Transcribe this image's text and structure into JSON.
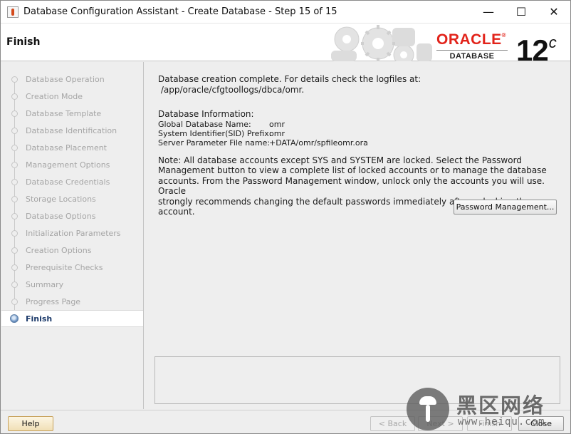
{
  "window": {
    "title": "Database Configuration Assistant - Create Database - Step 15 of 15",
    "minimize_glyph": "—",
    "maximize_glyph": "☐",
    "close_glyph": "✕"
  },
  "header": {
    "step_title": "Finish",
    "logo_word": "ORACLE",
    "logo_registered": "®",
    "logo_sub": "DATABASE",
    "version": "12",
    "version_suffix": "c"
  },
  "nav": {
    "items": [
      {
        "label": "Database Operation"
      },
      {
        "label": "Creation Mode"
      },
      {
        "label": "Database Template"
      },
      {
        "label": "Database Identification"
      },
      {
        "label": "Database Placement"
      },
      {
        "label": "Management Options"
      },
      {
        "label": "Database Credentials"
      },
      {
        "label": "Storage Locations"
      },
      {
        "label": "Database Options"
      },
      {
        "label": "Initialization Parameters"
      },
      {
        "label": "Creation Options"
      },
      {
        "label": "Prerequisite Checks"
      },
      {
        "label": "Summary"
      },
      {
        "label": "Progress Page"
      },
      {
        "label": "Finish",
        "active": true
      }
    ]
  },
  "main": {
    "completion_line1": "Database creation complete. For details check the logfiles at:",
    "completion_line2": " /app/oracle/cfgtoollogs/dbca/omr.",
    "info_heading": "Database Information:",
    "info": [
      {
        "key": "Global Database Name:",
        "value": "omr"
      },
      {
        "key": "System Identifier(SID) Prefix:",
        "value": "omr"
      },
      {
        "key": "Server Parameter File name:",
        "value": "+DATA/omr/spfileomr.ora"
      }
    ],
    "note_lines": [
      "Note: All database accounts except SYS and SYSTEM are locked. Select the Password",
      "Management button to view a complete list of locked accounts or to manage the database",
      "accounts. From the Password Management window, unlock only the accounts you will use. Oracle",
      "strongly recommends changing the default passwords immediately after unlocking the account."
    ],
    "password_button": "Password Management..."
  },
  "footer": {
    "help": "Help",
    "back": "< Back",
    "next": "Next >",
    "finish": "Finish",
    "close": "Close"
  },
  "watermark": {
    "chinese": "黑区网络",
    "url": "www.heiqu.com"
  },
  "colors": {
    "oracle_red": "#e2231a",
    "active_nav_text": "#1d3b6b"
  }
}
